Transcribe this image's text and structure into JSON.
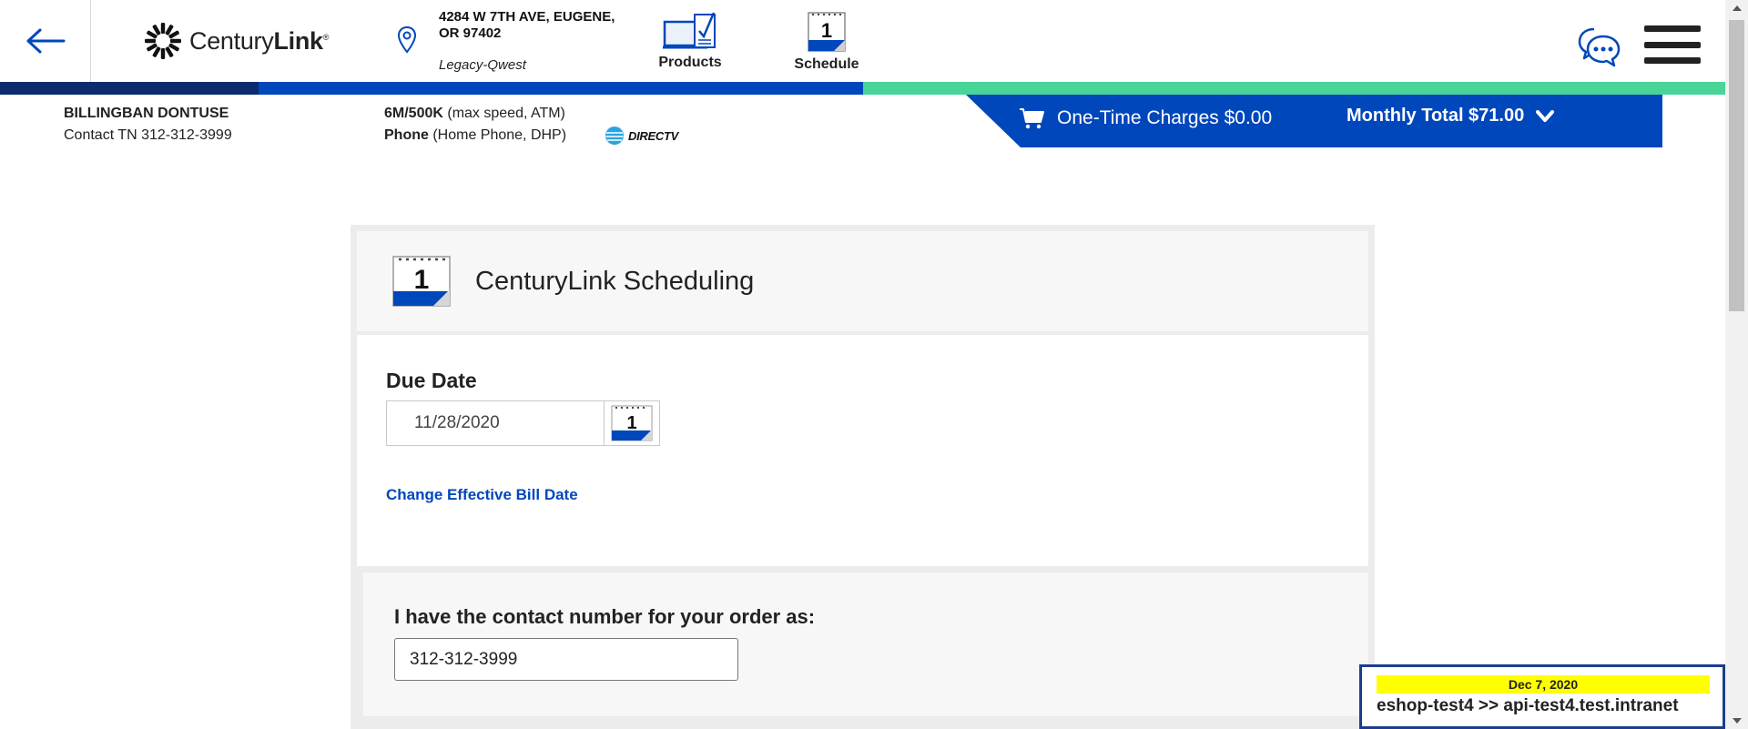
{
  "header": {
    "logo_text_regular": "Century",
    "logo_text_bold": "Link",
    "logo_mark": "®",
    "address": "4284 W 7TH AVE, EUGENE, OR 97402",
    "legacy": "Legacy-Qwest",
    "nav": {
      "products_label": "Products",
      "schedule_label": "Schedule"
    },
    "icons": {
      "back": "arrow-left-icon",
      "location": "location-pin-icon",
      "products": "monitor-checklist-icon",
      "schedule": "calendar-icon",
      "chat": "chat-bubble-icon",
      "menu": "hamburger-menu-icon"
    }
  },
  "progress": {
    "colors": [
      "#0b2a6f",
      "#0047bb",
      "#48d597"
    ]
  },
  "customer": {
    "name": "BILLINGBAN DONTUSE",
    "contact_tn": "Contact TN 312-312-3999"
  },
  "services": {
    "internet_bold": "6M/500K",
    "internet_detail": " (max speed, ATM)",
    "phone_bold": "Phone",
    "phone_detail": " (Home Phone, DHP)",
    "directv": "DIRECTV"
  },
  "charges": {
    "one_time": "One-Time Charges $0.00",
    "monthly": "Monthly Total $71.00",
    "accent": "#0047bb"
  },
  "scheduling": {
    "title": "CenturyLink Scheduling",
    "due_date_label": "Due Date",
    "due_date_value": "11/28/2020",
    "bill_date_link": "Change Effective Bill Date",
    "contact_label": "I have the contact number for your order as:",
    "contact_value": "312-312-3999"
  },
  "env": {
    "date": "Dec 7, 2020",
    "text": "eshop-test4 >> api-test4.test.intranet"
  }
}
